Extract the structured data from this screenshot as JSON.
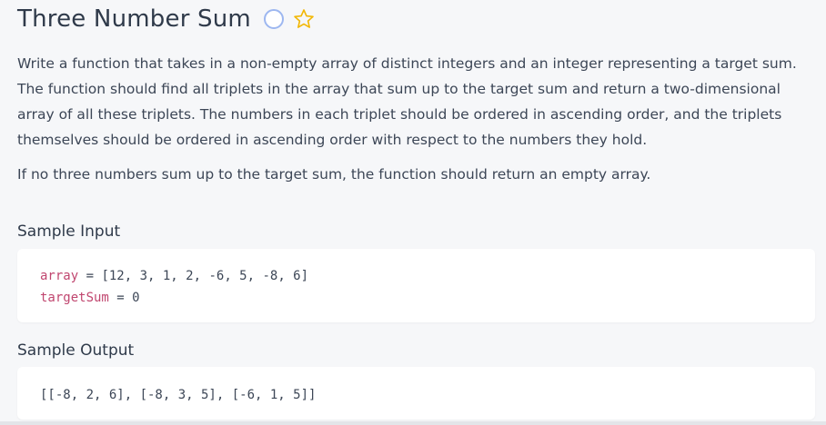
{
  "problem": {
    "title": "Three Number Sum",
    "description": [
      "Write a function that takes in a non-empty array of distinct integers and an integer representing a target sum. The function should find all triplets in the array that sum up to the target sum and return a two-dimensional array of all these triplets. The numbers in each triplet should be ordered in ascending order, and the triplets themselves should be ordered in ascending order with respect to the numbers they hold.",
      "If no three numbers sum up to the target sum, the function should return an empty array."
    ]
  },
  "icons": {
    "status": "circle-status-icon",
    "favorite": "star-outline-icon"
  },
  "sample_input": {
    "label": "Sample Input",
    "lines": [
      {
        "name": "array",
        "op": " = ",
        "value": "[12, 3, 1, 2, -6, 5, -8, 6]"
      },
      {
        "name": "targetSum",
        "op": " = ",
        "value": "0"
      }
    ]
  },
  "sample_output": {
    "label": "Sample Output",
    "value": "[[-8, 2, 6], [-8, 3, 5], [-6, 1, 5]]"
  },
  "colors": {
    "accent_blue": "#9db7f0",
    "star_yellow": "#f2b705",
    "variable_pink": "#c0466f"
  }
}
